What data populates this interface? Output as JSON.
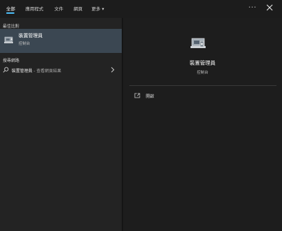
{
  "tabs": [
    {
      "label": "全部"
    },
    {
      "label": "應用程式"
    },
    {
      "label": "文件"
    },
    {
      "label": "網頁"
    },
    {
      "label": "更多 ▾"
    }
  ],
  "header": {
    "more_label": "···",
    "close_icon": "close-icon"
  },
  "colors": {
    "accent": "#4cc2ff",
    "selected_bg": "#3b4752",
    "left_bg": "#232323",
    "right_bg": "#1d1d1d"
  },
  "best_match": {
    "section_label": "最佳比對",
    "title": "裝置管理員",
    "subtitle": "控制台",
    "icon": "device-manager-icon"
  },
  "web_search": {
    "section_label": "搜尋網路",
    "query": "裝置管理員",
    "suffix": " - 查看網頁結果",
    "icon": "search-icon"
  },
  "details": {
    "title": "裝置管理員",
    "subtitle": "控制台",
    "icon": "device-manager-icon",
    "actions": [
      {
        "label": "開啟",
        "icon": "open-icon"
      }
    ]
  }
}
